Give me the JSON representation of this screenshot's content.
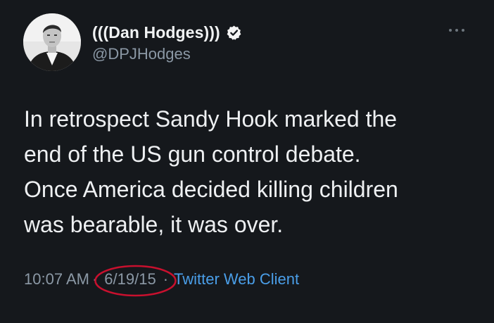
{
  "tweet": {
    "author": {
      "display_name": "(((Dan Hodges)))",
      "handle": "@DPJHodges",
      "verified_icon": "verified-badge-icon",
      "avatar_icon": "profile-photo"
    },
    "more_icon": "more-options-icon",
    "text_lines": [
      "In retrospect Sandy Hook marked the",
      "end of the US gun control debate.",
      "Once America decided killing children",
      "was bearable, it was over."
    ],
    "time": "10:07 AM",
    "separator": "·",
    "date": "6/19/15",
    "source": "Twitter Web Client",
    "colors": {
      "background": "#15181c",
      "text": "#eef0f2",
      "muted": "#8b98a5",
      "link": "#4a9ee8",
      "annotation": "#c8102e"
    }
  }
}
